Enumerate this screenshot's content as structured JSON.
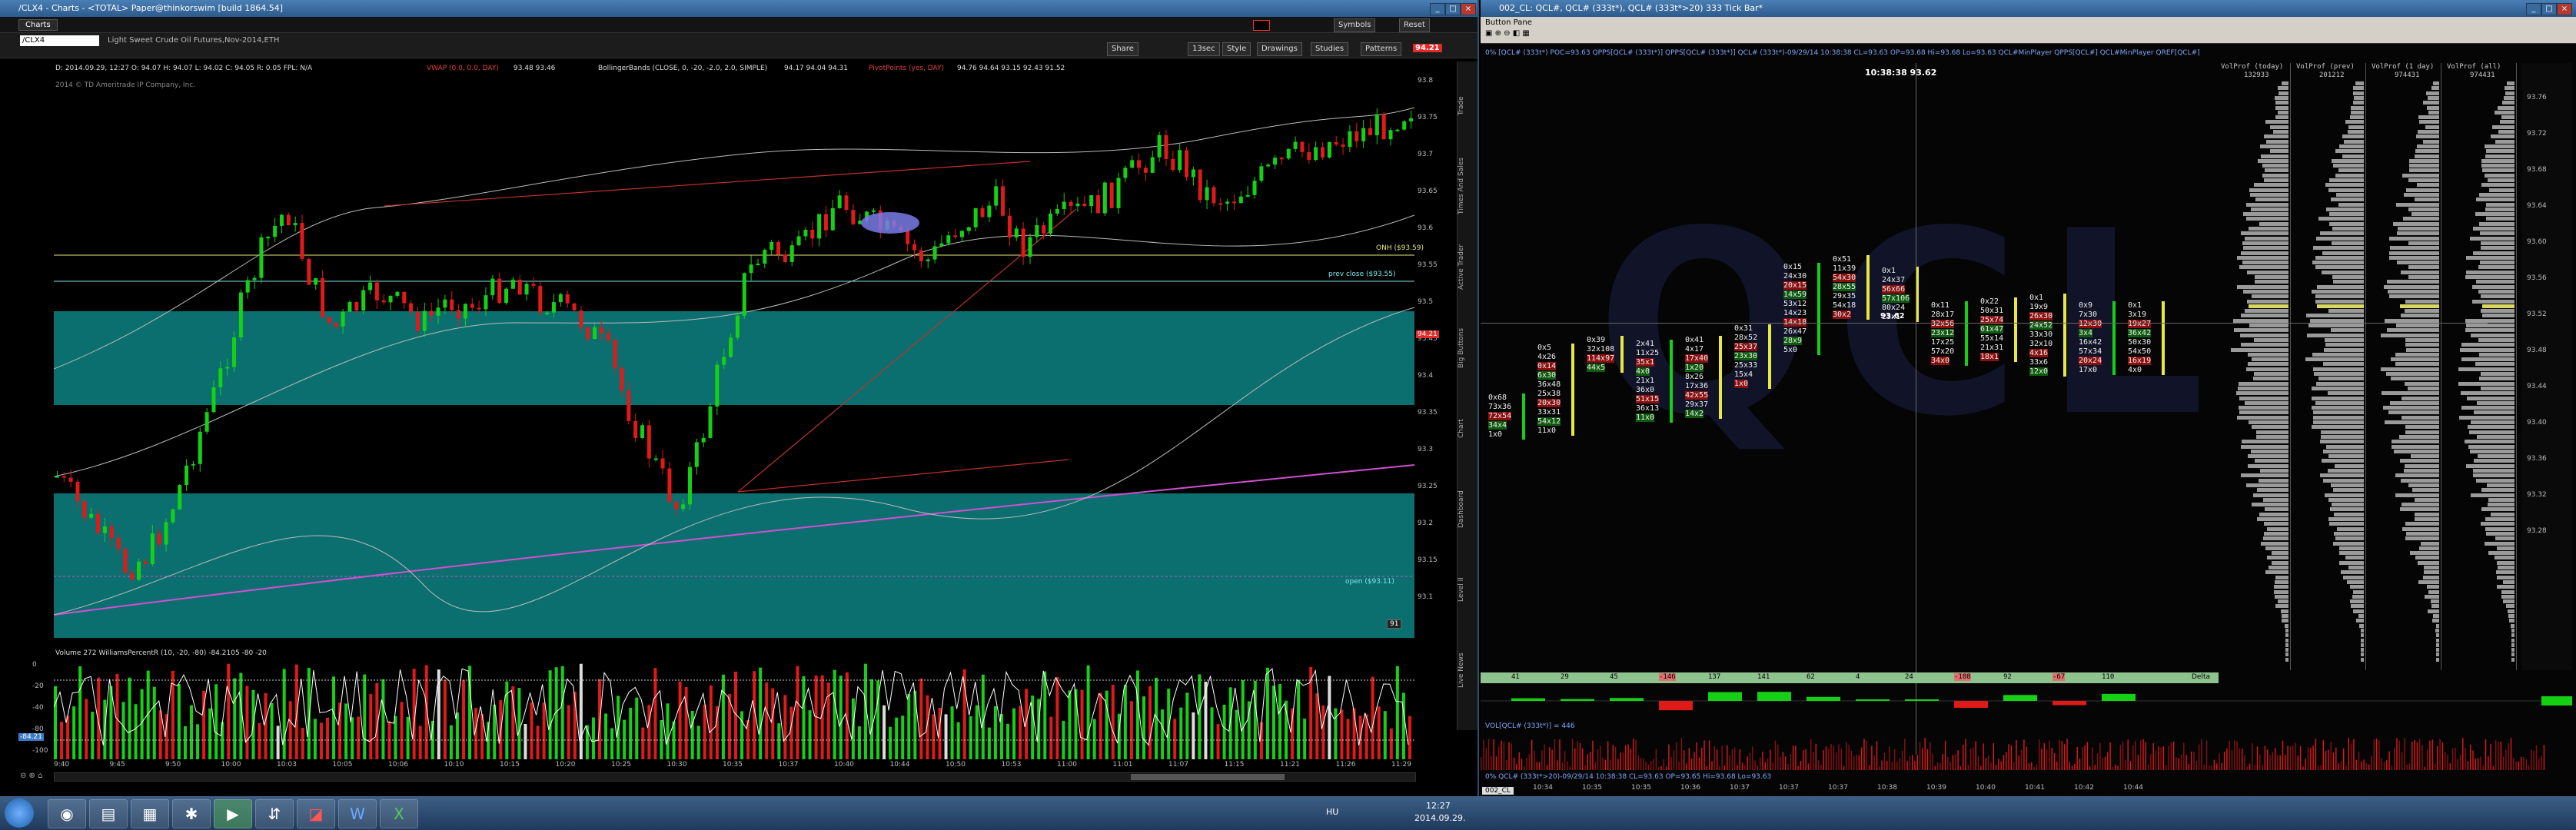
{
  "left_window": {
    "title": "/CLX4 - Charts - <TOTAL> Paper@thinkorswim [build 1864.54]",
    "tab_label": "Charts",
    "symbol": "/CLX4",
    "symbol_desc": "Light Sweet Crude Oil Futures,Nov-2014,ETH",
    "toolbar_buttons": [
      "Share",
      "Style",
      "Drawings",
      "Studies",
      "Patterns"
    ],
    "aggregation": "13sec",
    "right_buttons": [
      "Symbols",
      "Reset"
    ],
    "price_badge": "94.21",
    "company": "2014 © TD Ameritrade IP Company, Inc.",
    "ohlc_line": "D: 2014.09.29, 12:27  O: 94.07  H: 94.07  L: 94.02  C: 94.05  R: 0.05  FPL: N/A",
    "study_vwap": "VWAP (0.0, 0.0, DAY)",
    "vwap_values": "93.48  93.46",
    "study_bb": "BollingerBands (CLOSE, 0, -20, -2.0, 2.0, SIMPLE)",
    "bb_values": "94.17  94.04  94.31",
    "study_pivot": "PivotPoints (yes, DAY)",
    "pivot_values": "94.76  94.64  93.15  92.43  91.52",
    "lbl_onh": "ONH ($93.59)",
    "lbl_prev_close": "prev close ($93.55)",
    "lbl_open": "open ($93.11)",
    "lbl_91": "91",
    "y_axis": [
      "93.8",
      "93.75",
      "93.7",
      "93.65",
      "93.6",
      "93.55",
      "93.5",
      "93.45",
      "93.4",
      "93.35",
      "93.3",
      "93.25",
      "93.2",
      "93.15",
      "93.1"
    ],
    "x_axis": [
      "9:40",
      "9:45",
      "9:50",
      "10:00",
      "10:03",
      "10:05",
      "10:06",
      "10:10",
      "10:15",
      "10:20",
      "10:25",
      "10:30",
      "10:35",
      "10:37",
      "10:40",
      "10:44",
      "10:50",
      "10:53",
      "11:00",
      "11:01",
      "11:07",
      "11:15",
      "11:21",
      "11:26",
      "11:29"
    ],
    "lower_study": "Volume  272  WilliamsPercentR (10, -20, -80)  -84.2105  -80  -20",
    "lower_y": [
      "0",
      "-20",
      "-40",
      "-80",
      "-100"
    ],
    "side_tabs": [
      "Trade",
      "Times And Sales",
      "Active Trader",
      "Big Buttons",
      "Chart",
      "Dashboard",
      "Level II",
      "Live News"
    ],
    "wr_badge": "-84.21"
  },
  "right_window": {
    "title": "002_CL: QCL#, QCL# (333t*), QCL# (333t*>20) 333 Tick Bar*",
    "button_pane": "Button Pane",
    "legend_line": "0% [QCL# (333t*) POC=93.63  QPPS[QCL# (333t*)]  QPPS[QCL# (333t*)]  QCL# (333t*)-09/29/14 10:38:38 CL=93.63 OP=93.68 Hi=93.68 Lo=93.63  QCL#MinPlayer  QPPS[QCL#]  QCL#MinPlayer  QREF[QCL#]",
    "crosshair_time": "10:38:38 93.62",
    "watermark": "QCL",
    "vol_headers": [
      "VolProf (today)",
      "VolProf (prev)",
      "VolProf (1 day)",
      "VolProf (all)"
    ],
    "vol_counts": [
      "132933",
      "201212",
      "974431",
      "974431"
    ],
    "y_axis": [
      "93.76",
      "93.72",
      "93.68",
      "93.64",
      "93.60",
      "93.56",
      "93.52",
      "93.48",
      "93.44",
      "93.40",
      "93.36",
      "93.32",
      "93.28"
    ],
    "delta_values": [
      "41",
      "29",
      "45",
      "-146",
      "137",
      "141",
      "62",
      "4",
      "24",
      "-108",
      "92",
      "-67",
      "110"
    ],
    "delta_label": "Delta",
    "vol_legend": "VOL[QCL# (333t*)] = 446",
    "bottom_legend": "0% QCL# (333t*>20)-09/29/14 10:38:38 CL=93.63 OP=93.65 Hi=93.68 Lo=93.63",
    "x_axis": [
      "10:34",
      "10:35",
      "10:35",
      "10:36",
      "10:37",
      "10:37",
      "10:37",
      "10:38",
      "10:39",
      "10:40",
      "10:41",
      "10:42",
      "10:44"
    ],
    "tab": "002_CL",
    "price_marker": "93.62"
  },
  "footprint": [
    {
      "col": 0,
      "lines": [
        "0x68",
        "73x36",
        "72x54",
        "34x4",
        "1x0"
      ]
    },
    {
      "col": 1,
      "lines": [
        "0x5",
        "4x26",
        "0x14",
        "6x30",
        "36x48",
        "25x38",
        "20x30",
        "33x31",
        "54x12",
        "11x0"
      ]
    },
    {
      "col": 2,
      "lines": [
        "0x39",
        "32x108",
        "114x97",
        "44x5"
      ]
    },
    {
      "col": 3,
      "lines": [
        "2x41",
        "11x25",
        "35x1",
        "4x0",
        "21x1",
        "36x0",
        "51x15",
        "36x13",
        "11x0"
      ]
    },
    {
      "col": 4,
      "lines": [
        "0x41",
        "4x17",
        "17x40",
        "1x20",
        "8x26",
        "17x36",
        "42x55",
        "29x37",
        "14x2"
      ]
    },
    {
      "col": 5,
      "lines": [
        "0x31",
        "28x52",
        "25x37",
        "23x30",
        "25x33",
        "15x4",
        "1x0"
      ]
    },
    {
      "col": 6,
      "lines": [
        "0x15",
        "24x30",
        "20x15",
        "14x59",
        "53x12",
        "14x23",
        "14x18",
        "26x47",
        "28x9",
        "5x0"
      ]
    },
    {
      "col": 7,
      "lines": [
        "0x51",
        "11x39",
        "54x30",
        "28x55",
        "29x35",
        "54x18",
        "30x2"
      ]
    },
    {
      "col": 8,
      "lines": [
        "0x1",
        "24x37",
        "56x66",
        "57x106",
        "80x24",
        "23x1"
      ]
    },
    {
      "col": 9,
      "lines": [
        "0x11",
        "28x17",
        "32x56",
        "23x12",
        "17x25",
        "57x20",
        "34x0"
      ]
    },
    {
      "col": 10,
      "lines": [
        "0x22",
        "50x31",
        "25x74",
        "61x47",
        "55x14",
        "21x31",
        "18x1"
      ]
    },
    {
      "col": 11,
      "lines": [
        "0x1",
        "19x9",
        "26x30",
        "24x52",
        "33x30",
        "32x10",
        "4x16",
        "33x6",
        "12x0"
      ]
    },
    {
      "col": 12,
      "lines": [
        "0x9",
        "7x30",
        "12x30",
        "3x4",
        "16x42",
        "57x34",
        "20x24",
        "17x0"
      ]
    },
    {
      "col": 13,
      "lines": [
        "0x1",
        "3x19",
        "19x27",
        "36x42",
        "50x30",
        "54x50",
        "16x19",
        "4x0"
      ]
    }
  ],
  "taskbar": {
    "lang": "HU",
    "time": "12:27",
    "date": "2014.09.29.",
    "icons": [
      "start-orb-icon",
      "chrome-icon",
      "explorer-icon",
      "files-icon",
      "app-icon",
      "thinkorswim-icon",
      "arrow-app-icon",
      "red-app-icon",
      "word-icon",
      "excel-icon"
    ]
  },
  "colors": {
    "teal_band": "#0b6f6f",
    "bull": "#16d016",
    "bear": "#e01919",
    "magenta": "#d24fd2",
    "badge_red": "#e02b2b"
  }
}
